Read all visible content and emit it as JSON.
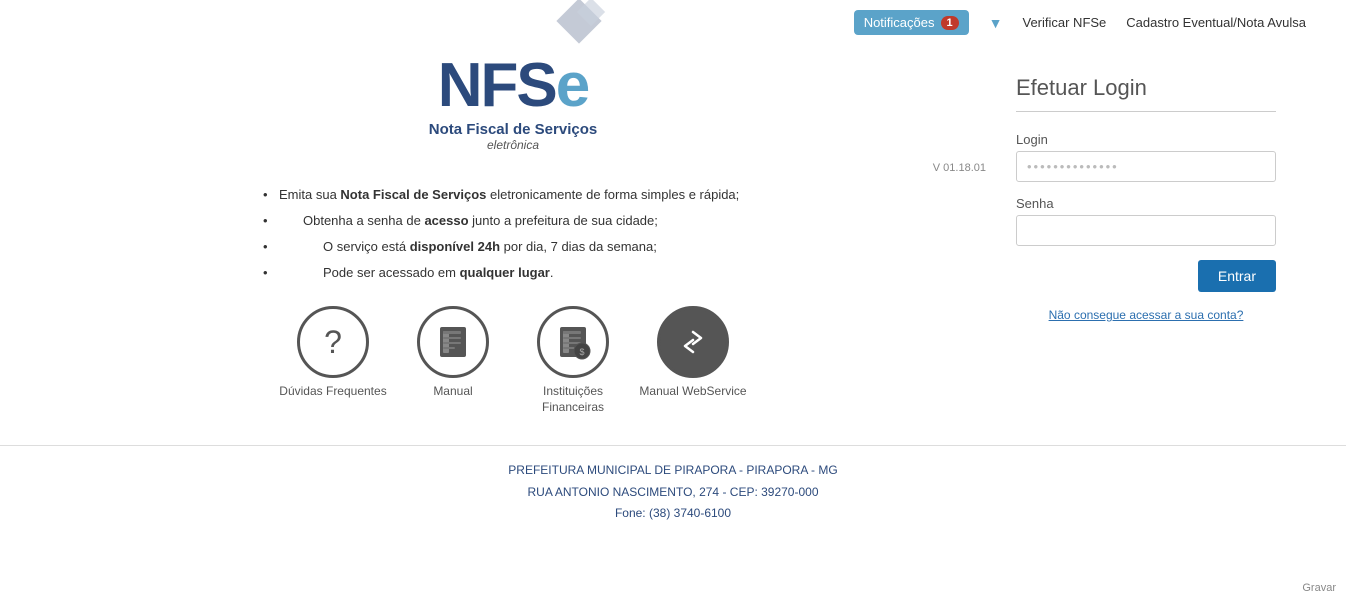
{
  "topnav": {
    "notif_label": "Notificações",
    "notif_count": "1",
    "arrow": "▼",
    "verify_link": "Verificar NFSe",
    "cadastro_link": "Cadastro Eventual/Nota Avulsa"
  },
  "logo": {
    "nfs": "NFS",
    "e": "e",
    "subtitle": "Nota Fiscal de Serviços",
    "subtitle2": "eletrônica",
    "version": "V 01.18.01"
  },
  "bullets": [
    {
      "text": "Emita sua ",
      "bold": "Nota Fiscal de Serviços",
      "rest": " eletronicamente de forma simples e rápida;"
    },
    {
      "text": "Obtenha a senha de ",
      "bold": "acesso",
      "rest": " junto a prefeitura de sua cidade;"
    },
    {
      "text": "O serviço está ",
      "bold": "disponível 24h",
      "rest": " por dia, 7 dias da semana;"
    },
    {
      "text": "Pode ser acessado em ",
      "bold": "qualquer lugar",
      "rest": "."
    }
  ],
  "icons": [
    {
      "id": "faq",
      "symbol": "?",
      "label": "Dúvidas Frequentes",
      "dark": false
    },
    {
      "id": "manual",
      "symbol": "📓",
      "label": "Manual",
      "dark": false
    },
    {
      "id": "finance",
      "symbol": "📔",
      "label": "Instituições Financeiras",
      "dark": false
    },
    {
      "id": "webservice",
      "symbol": "⇅",
      "label": "Manual WebService",
      "dark": true
    }
  ],
  "login": {
    "title": "Efetuar Login",
    "login_label": "Login",
    "login_placeholder": "••••••••••••••",
    "senha_label": "Senha",
    "senha_placeholder": "",
    "entrar": "Entrar",
    "forgot": "Não consegue acessar a sua conta?"
  },
  "footer": {
    "line1": "PREFEITURA MUNICIPAL DE PIRAPORA - PIRAPORA - MG",
    "line2": "RUA ANTONIO NASCIMENTO, 274 - CEP: 39270-000",
    "line3": "Fone: (38) 3740-6100"
  },
  "gravar": "Gravar"
}
